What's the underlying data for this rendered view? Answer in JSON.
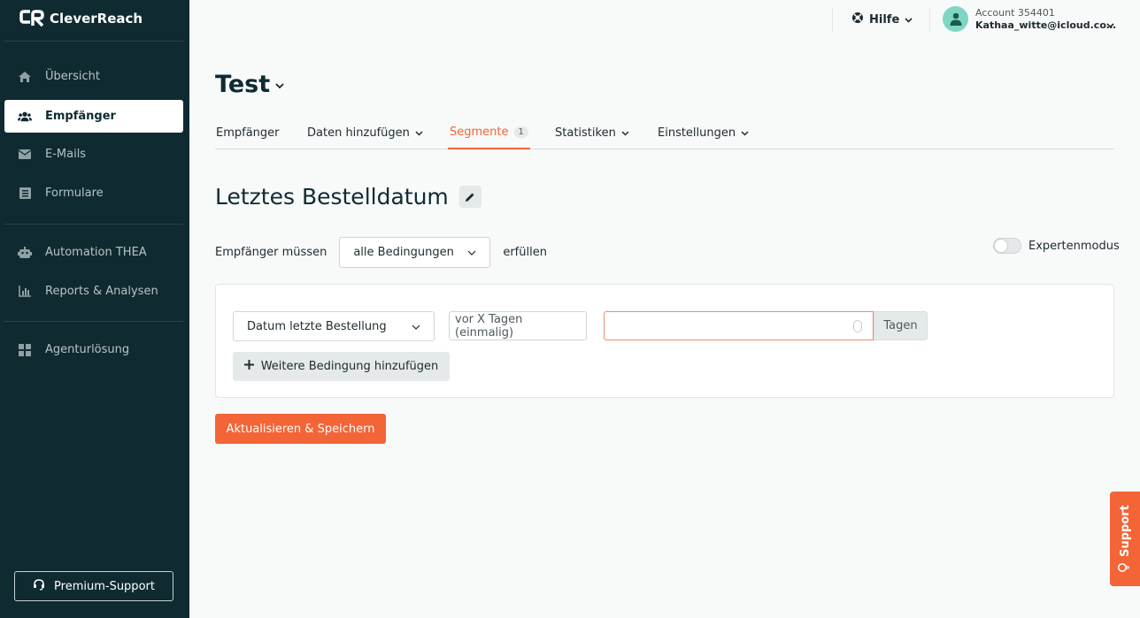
{
  "brand": {
    "name": "CleverReach"
  },
  "sidebar": {
    "items": [
      {
        "label": "Übersicht",
        "icon": "home-icon"
      },
      {
        "label": "Empfänger",
        "icon": "users-icon",
        "active": true
      },
      {
        "label": "E-Mails",
        "icon": "mail-icon"
      },
      {
        "label": "Formulare",
        "icon": "form-icon"
      },
      {
        "label": "Automation THEA",
        "icon": "robot-icon"
      },
      {
        "label": "Reports & Analysen",
        "icon": "chart-icon"
      },
      {
        "label": "Agenturlösung",
        "icon": "grid-icon"
      }
    ],
    "premium_support": "Premium-Support"
  },
  "topbar": {
    "help": "Hilfe",
    "account_id": "Account 354401",
    "account_email": "Kathaa_witte@icloud.co…"
  },
  "page": {
    "title": "Test",
    "tabs": [
      {
        "label": "Empfänger"
      },
      {
        "label": "Daten hinzufügen"
      },
      {
        "label": "Segmente",
        "badge": "1"
      },
      {
        "label": "Statistiken"
      },
      {
        "label": "Einstellungen"
      }
    ]
  },
  "segment": {
    "title": "Letztes Bestelldatum",
    "condition_prefix": "Empfänger müssen",
    "condition_mode": "alle Bedingungen",
    "condition_suffix": "erfüllen",
    "expert_mode": "Expertenmodus",
    "rule": {
      "field": "Datum letzte Bestellung",
      "operator": "vor X Tagen (einmalig)",
      "value": "",
      "unit": "Tagen"
    },
    "add_condition": "Weitere Bedingung hinzufügen",
    "save": "Aktualisieren & Speichern"
  },
  "support": "Support",
  "colors": {
    "sidebar": "#0f2a31",
    "accent": "#f36436"
  }
}
